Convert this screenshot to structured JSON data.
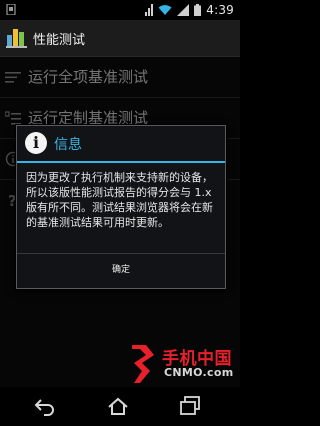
{
  "status_bar": {
    "time": "4:39"
  },
  "app": {
    "title": "性能测试",
    "icon": "benchmark-bars-icon"
  },
  "list": {
    "items": [
      {
        "label": "运行全项基准测试",
        "icon": "list-lines-icon"
      },
      {
        "label": "运行定制基准测试",
        "icon": "custom-list-icon"
      },
      {
        "label": "",
        "icon": "info-circle-icon"
      },
      {
        "label": "",
        "icon": "help-question-icon"
      }
    ]
  },
  "dialog": {
    "title": "信息",
    "icon": "info-icon",
    "message": "因为更改了执行机制来支持新的设备，所以该版性能测试报告的得分会与 1.x 版有所不同。测试结果浏览器将会在新的基准测试结果可用时更新。",
    "button_label": "确定",
    "accent_color": "#33b5e5"
  },
  "watermark": {
    "brand": "手机中国",
    "domain": "CNMO.com",
    "color": "#e8202a"
  },
  "nav": {
    "back_icon": "back-icon",
    "home_icon": "home-icon",
    "recents_icon": "recents-icon"
  }
}
